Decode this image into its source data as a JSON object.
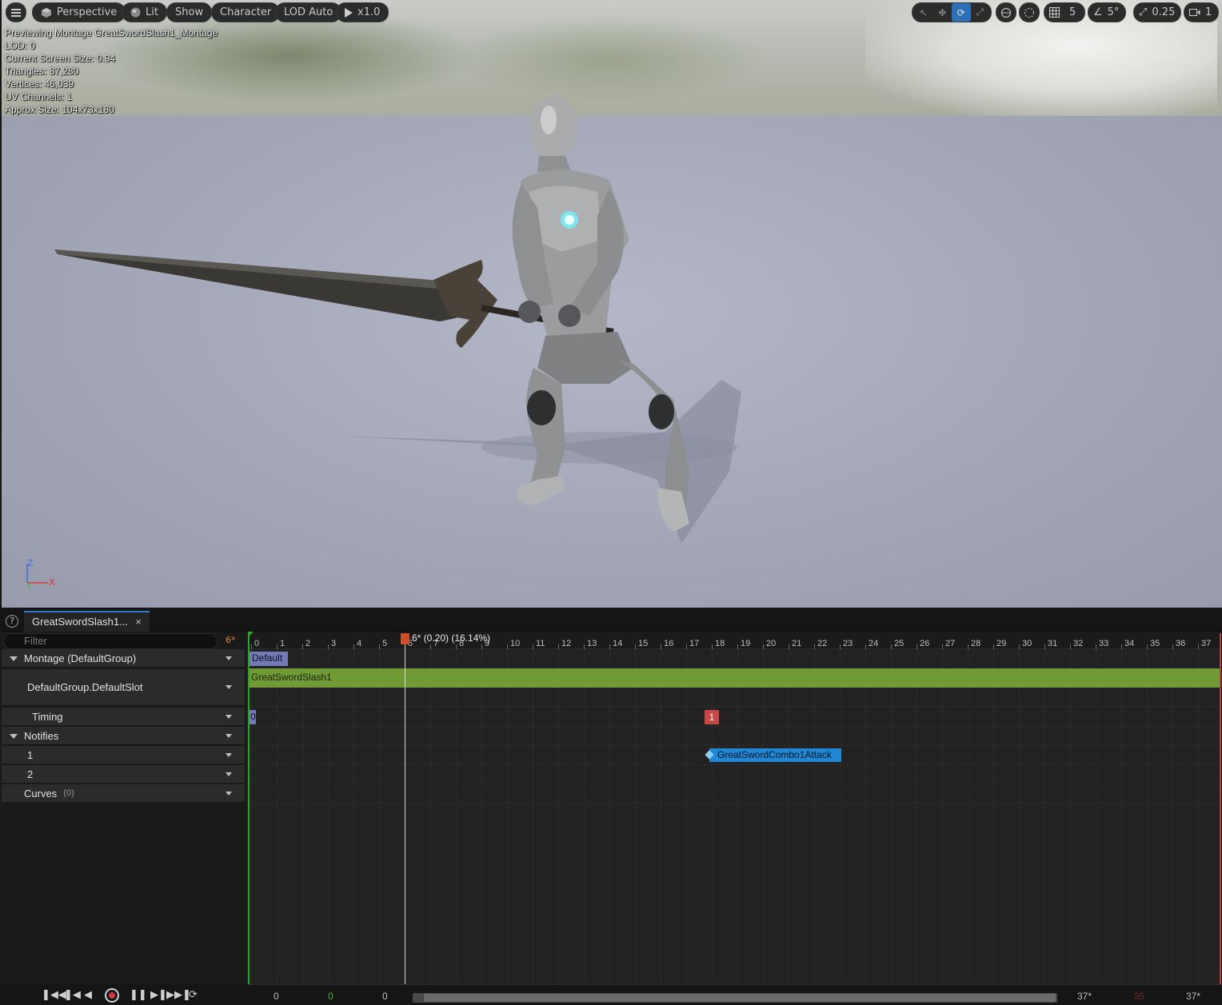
{
  "viewport": {
    "toolbar": {
      "menu_icon": "hamburger-icon",
      "perspective_label": "Perspective",
      "lit_label": "Lit",
      "show_label": "Show",
      "character_label": "Character",
      "lod_label": "LOD Auto",
      "playback_rate": "x1.0",
      "grid_snap_value": "5",
      "rotate_snap_value": "5°",
      "scale_snap_value": "0.25",
      "camera_speed_value": "1"
    },
    "stats": {
      "previewing": "Previewing Montage GreatSwordSlash1_Montage",
      "lod": "LOD: 0",
      "screen_size": "Current Screen Size: 0.94",
      "triangles": "Triangles: 87,280",
      "vertices": "Vertices: 46,039",
      "uv_channels": "UV Channels: 1",
      "approx_size": "Approx Size: 104x73x180"
    },
    "axis": {
      "z": "Z",
      "x": "X"
    }
  },
  "editor": {
    "tab_title": "GreatSwordSlash1...",
    "tab_close": "×",
    "help": "?",
    "filter_placeholder": "Filter",
    "current_frame_badge": "6*",
    "tracks": {
      "montage": "Montage (DefaultGroup)",
      "slot": "DefaultGroup.DefaultSlot",
      "timing": "Timing",
      "notifies": "Notifies",
      "notify_track_1": "1",
      "notify_track_2": "2",
      "curves": "Curves",
      "curves_count": "(0)"
    },
    "timeline": {
      "ticks": [
        "0",
        "1",
        "2",
        "3",
        "4",
        "5",
        "6",
        "7",
        "8",
        "9",
        "10",
        "11",
        "12",
        "13",
        "14",
        "15",
        "16",
        "17",
        "18",
        "19",
        "20",
        "21",
        "22",
        "23",
        "24",
        "25",
        "26",
        "27",
        "28",
        "29",
        "30",
        "31",
        "32",
        "33",
        "34",
        "35",
        "36",
        "37"
      ],
      "scrub_label": "6* (0.20) (16.14%)",
      "section_label": "Default",
      "segment_label": "GreatSwordSlash1",
      "timing_marker_0": "0",
      "timing_marker_1": "1",
      "notify_label": "GreatSwordCombo1Attack"
    },
    "transport": {
      "start_frame": "0",
      "current_frame_green": "0",
      "offset_frame": "0",
      "end_frame_a": "37*",
      "end_frame_red": "35",
      "end_frame_b": "37*"
    }
  }
}
